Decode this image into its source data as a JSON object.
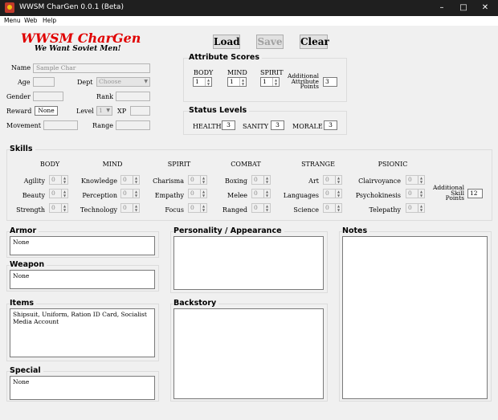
{
  "window": {
    "title": "WWSM CharGen 0.0.1 (Beta)",
    "minimize": "–",
    "maximize": "□",
    "close": "✕"
  },
  "menu": [
    "Menu",
    "Web",
    "Help"
  ],
  "brand": {
    "name": "WWSM CharGen",
    "slogan": "We Want Soviet Men!"
  },
  "buttons": {
    "load": "Load",
    "save": "Save",
    "clear": "Clear"
  },
  "character": {
    "name_label": "Name",
    "name_placeholder": "Sample Char",
    "age_label": "Age",
    "age": "",
    "dept_label": "Dept",
    "dept": "Choose",
    "gender_label": "Gender",
    "gender": "",
    "rank_label": "Rank",
    "rank": "",
    "reward_label": "Reward",
    "reward": "None",
    "level_label": "Level",
    "level": "1",
    "xp_label": "XP",
    "xp": "",
    "movement_label": "Movement",
    "movement": "",
    "range_label": "Range",
    "range": ""
  },
  "attributes": {
    "title": "Attribute Scores",
    "items": [
      {
        "label": "BODY",
        "value": "1"
      },
      {
        "label": "MIND",
        "value": "1"
      },
      {
        "label": "SPIRIT",
        "value": "1"
      }
    ],
    "additional_label": [
      "Additional",
      "Attribute",
      "Points"
    ],
    "additional_value": "3"
  },
  "status": {
    "title": "Status Levels",
    "items": [
      {
        "label": "HEALTH",
        "value": "3"
      },
      {
        "label": "SANITY",
        "value": "3"
      },
      {
        "label": "MORALE",
        "value": "3"
      }
    ]
  },
  "skills": {
    "title": "Skills",
    "columns": [
      {
        "head": "BODY",
        "skills": [
          {
            "label": "Agility",
            "value": "0"
          },
          {
            "label": "Beauty",
            "value": "0"
          },
          {
            "label": "Strength",
            "value": "0"
          }
        ]
      },
      {
        "head": "MIND",
        "skills": [
          {
            "label": "Knowledge",
            "value": "0"
          },
          {
            "label": "Perception",
            "value": "0"
          },
          {
            "label": "Technology",
            "value": "0"
          }
        ]
      },
      {
        "head": "SPIRIT",
        "skills": [
          {
            "label": "Charisma",
            "value": "0"
          },
          {
            "label": "Empathy",
            "value": "0"
          },
          {
            "label": "Focus",
            "value": "0"
          }
        ]
      },
      {
        "head": "COMBAT",
        "skills": [
          {
            "label": "Boxing",
            "value": "0"
          },
          {
            "label": "Melee",
            "value": "0"
          },
          {
            "label": "Ranged",
            "value": "0"
          }
        ]
      },
      {
        "head": "STRANGE",
        "skills": [
          {
            "label": "Art",
            "value": "0"
          },
          {
            "label": "Languages",
            "value": "0"
          },
          {
            "label": "Science",
            "value": "0"
          }
        ]
      },
      {
        "head": "PSIONIC",
        "skills": [
          {
            "label": "Clairvoyance",
            "value": "0"
          },
          {
            "label": "Psychokinesis",
            "value": "0"
          },
          {
            "label": "Telepathy",
            "value": "0"
          }
        ]
      }
    ],
    "additional_label": [
      "Additional",
      "Skill",
      "Points"
    ],
    "additional_value": "12"
  },
  "sections": {
    "armor": {
      "title": "Armor",
      "value": "None"
    },
    "weapon": {
      "title": "Weapon",
      "value": "None"
    },
    "items": {
      "title": "Items",
      "value": "Shipsuit, Uniform, Ration ID Card, Socialist Media Account"
    },
    "special": {
      "title": "Special",
      "value": "None"
    },
    "personality": {
      "title": "Personality / Appearance",
      "value": ""
    },
    "backstory": {
      "title": "Backstory",
      "value": ""
    },
    "notes": {
      "title": "Notes",
      "value": ""
    }
  }
}
